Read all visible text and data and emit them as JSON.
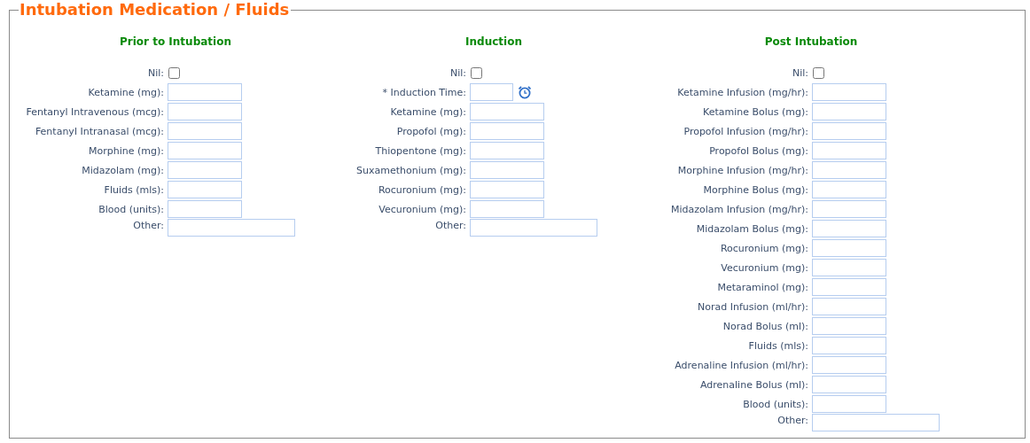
{
  "title": "Intubation Medication / Fluids",
  "sections": [
    {
      "heading": "Prior to Intubation",
      "nil": {
        "label": "Nil:",
        "checked": false
      },
      "fields": [
        {
          "label": "Ketamine (mg):",
          "kind": "number"
        },
        {
          "label": "Fentanyl Intravenous (mcg):",
          "kind": "number"
        },
        {
          "label": "Fentanyl Intranasal (mcg):",
          "kind": "number"
        },
        {
          "label": "Morphine (mg):",
          "kind": "number"
        },
        {
          "label": "Midazolam (mg):",
          "kind": "number"
        },
        {
          "label": "Fluids (mls):",
          "kind": "number"
        },
        {
          "label": "Blood (units):",
          "kind": "number"
        },
        {
          "label": "Other:",
          "kind": "text"
        }
      ]
    },
    {
      "heading": "Induction",
      "nil": {
        "label": "Nil:",
        "checked": false
      },
      "fields": [
        {
          "label": "* Induction Time:",
          "kind": "time"
        },
        {
          "label": "Ketamine (mg):",
          "kind": "number"
        },
        {
          "label": "Propofol (mg):",
          "kind": "number"
        },
        {
          "label": "Thiopentone (mg):",
          "kind": "number"
        },
        {
          "label": "Suxamethonium (mg):",
          "kind": "number"
        },
        {
          "label": "Rocuronium (mg):",
          "kind": "number"
        },
        {
          "label": "Vecuronium (mg):",
          "kind": "number"
        },
        {
          "label": "Other:",
          "kind": "text"
        }
      ]
    },
    {
      "heading": "Post Intubation",
      "nil": {
        "label": "Nil:",
        "checked": false
      },
      "fields": [
        {
          "label": "Ketamine Infusion (mg/hr):",
          "kind": "number"
        },
        {
          "label": "Ketamine Bolus (mg):",
          "kind": "number"
        },
        {
          "label": "Propofol Infusion (mg/hr):",
          "kind": "number"
        },
        {
          "label": "Propofol Bolus (mg):",
          "kind": "number"
        },
        {
          "label": "Morphine Infusion (mg/hr):",
          "kind": "number"
        },
        {
          "label": "Morphine Bolus (mg):",
          "kind": "number"
        },
        {
          "label": "Midazolam Infusion (mg/hr):",
          "kind": "number"
        },
        {
          "label": "Midazolam Bolus (mg):",
          "kind": "number"
        },
        {
          "label": "Rocuronium (mg):",
          "kind": "number"
        },
        {
          "label": "Vecuronium (mg):",
          "kind": "number"
        },
        {
          "label": "Metaraminol (mg):",
          "kind": "number"
        },
        {
          "label": "Norad Infusion (ml/hr):",
          "kind": "number"
        },
        {
          "label": "Norad Bolus (ml):",
          "kind": "number"
        },
        {
          "label": "Fluids (mls):",
          "kind": "number"
        },
        {
          "label": "Adrenaline Infusion (ml/hr):",
          "kind": "number"
        },
        {
          "label": "Adrenaline Bolus (ml):",
          "kind": "number"
        },
        {
          "label": "Blood (units):",
          "kind": "number"
        },
        {
          "label": "Other:",
          "kind": "text"
        }
      ]
    }
  ]
}
